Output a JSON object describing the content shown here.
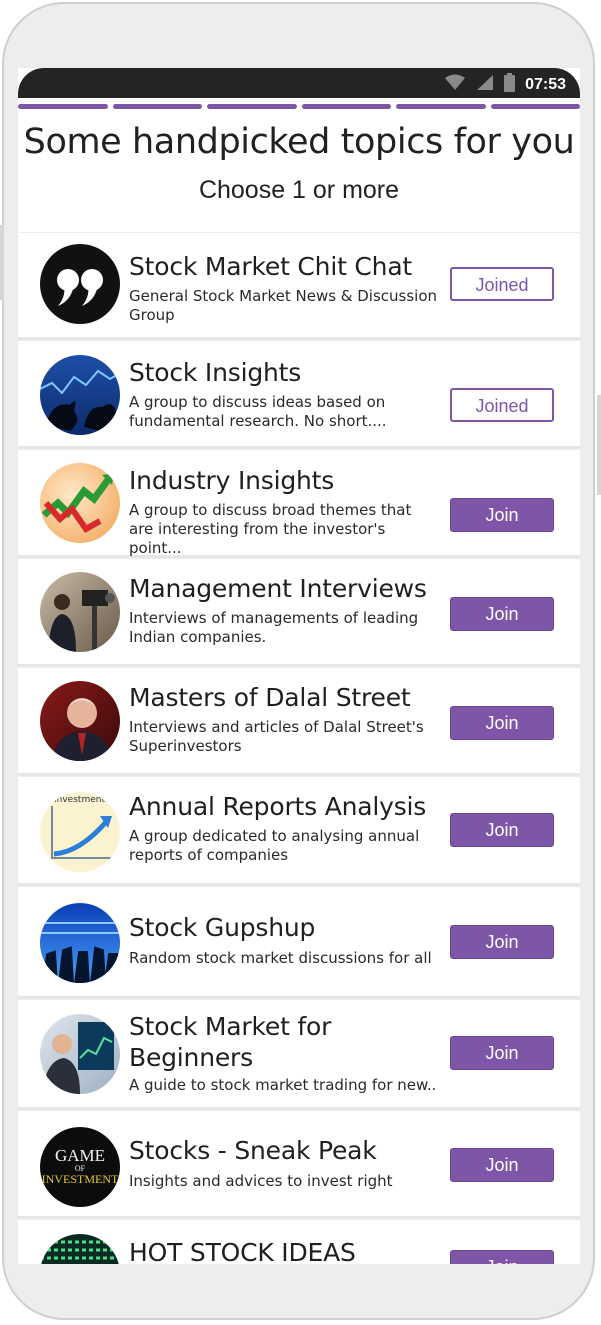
{
  "status_bar": {
    "time": "07:53",
    "icons": [
      "wifi-icon",
      "signal-icon",
      "battery-icon"
    ]
  },
  "progress_segments": 6,
  "header": {
    "title": "Some handpicked topics for you",
    "subtitle": "Choose 1 or more"
  },
  "colors": {
    "accent": "#7e56a7",
    "status_bar": "#242424",
    "text": "#212121"
  },
  "topics": [
    {
      "title": "Stock Market Chit Chat",
      "desc": "General Stock Market News & Discussion Group",
      "button": "Joined",
      "joined": true,
      "icon": "quote-icon"
    },
    {
      "title": "Stock Insights",
      "desc": "A group to discuss ideas based on fundamental research. No short....",
      "button": "Joined",
      "joined": true,
      "icon": "bull-bear-icon"
    },
    {
      "title": "Industry Insights",
      "desc": "A group to discuss broad themes that are interesting from the investor's point...",
      "button": "Join",
      "joined": false,
      "icon": "trend-arrow-icon"
    },
    {
      "title": "Management Interviews",
      "desc": "Interviews of managements of leading Indian companies.",
      "button": "Join",
      "joined": false,
      "icon": "interview-camera-icon"
    },
    {
      "title": "Masters of Dalal Street",
      "desc": "Interviews and articles of Dalal Street's Superinvestors",
      "button": "Join",
      "joined": false,
      "icon": "investor-portrait-icon"
    },
    {
      "title": "Annual Reports Analysis",
      "desc": "A group dedicated to analysing annual reports of companies",
      "button": "Join",
      "joined": false,
      "icon": "investment-chart-icon",
      "icon_text": "Investment"
    },
    {
      "title": "Stock Gupshup",
      "desc": "Random stock market discussions for all",
      "button": "Join",
      "joined": false,
      "icon": "crowd-ticker-icon"
    },
    {
      "title": "Stock Market for Beginners",
      "desc": "A guide to stock market trading for new..",
      "button": "Join",
      "joined": false,
      "icon": "trader-screens-icon"
    },
    {
      "title": "Stocks - Sneak Peak",
      "desc": "Insights and advices to invest right",
      "button": "Join",
      "joined": false,
      "icon": "game-of-investment-icon",
      "icon_text_1": "GAME",
      "icon_text_2": "OF",
      "icon_text_3": "INVESTMENT"
    },
    {
      "title": "HOT STOCK IDEAS",
      "desc": "",
      "button": "Join",
      "joined": false,
      "icon": "ticker-board-icon"
    }
  ]
}
